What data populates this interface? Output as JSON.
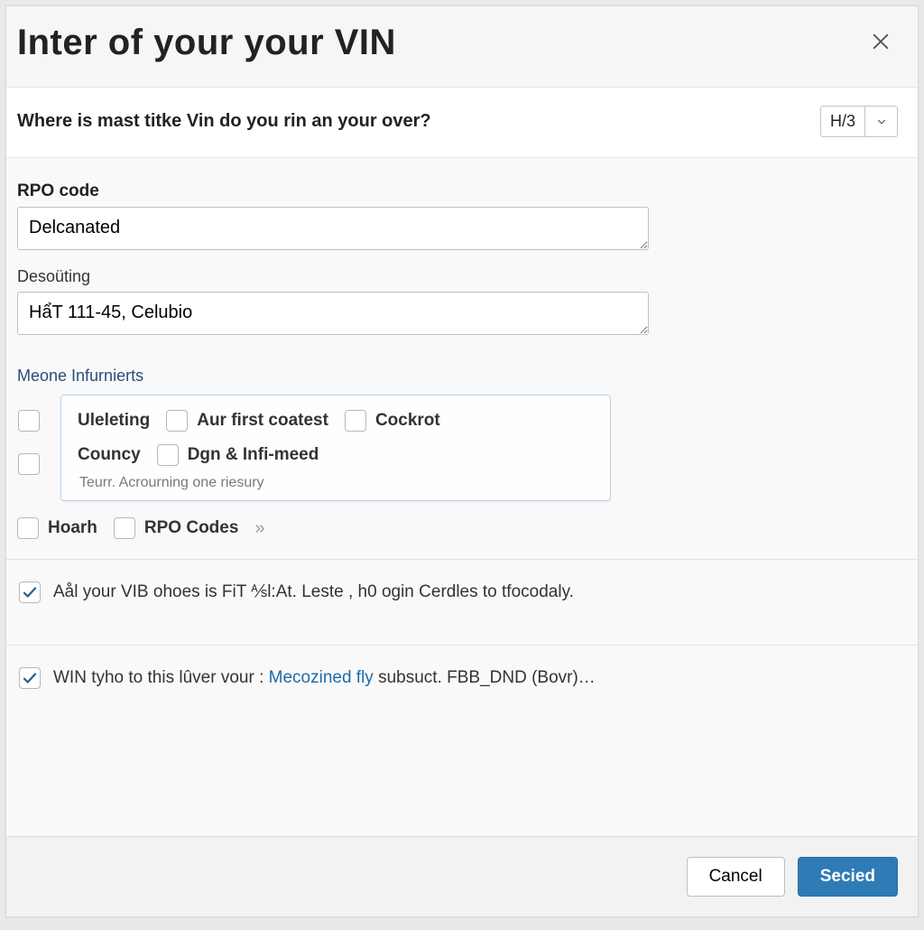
{
  "dialog": {
    "title": "Inter of your your VIN",
    "close_icon": "close"
  },
  "question": {
    "text": "Where is mast titke Vin do you rin an your over?",
    "page_indicator": "H/3"
  },
  "fields": {
    "rpo": {
      "label": "RPO code",
      "value": "Delcanated"
    },
    "desc": {
      "label": "Desoüting",
      "value": "HẩT 111-45, Celubio"
    }
  },
  "options": {
    "section_label": "Meone Infurnierts",
    "items": {
      "uleleting": "Uleleting",
      "aur_first": "Aur first coatest",
      "cockrot": "Cockrot",
      "councy": "Councy",
      "dgn_inf": "Dgn & Infi-meed"
    },
    "hint": "Teurr. Acrourning one riesury",
    "row3": {
      "hoarh": "Hoarh",
      "rpo_codes": "RPO Codes"
    }
  },
  "agree1": {
    "text_a": "Aål your VIB ohoes is FiT ⅍l:At. Leste ",
    "text_b": ", h0 ogin Cerdles to tfocodaly."
  },
  "agree2": {
    "text_a": "WIN tyho to this lûver vour :  ",
    "link": "Mecozined fly",
    "text_b": "  subsuct. FBB_DND (Bovr)…"
  },
  "footer": {
    "cancel": "Cancel",
    "submit": "Secied"
  }
}
